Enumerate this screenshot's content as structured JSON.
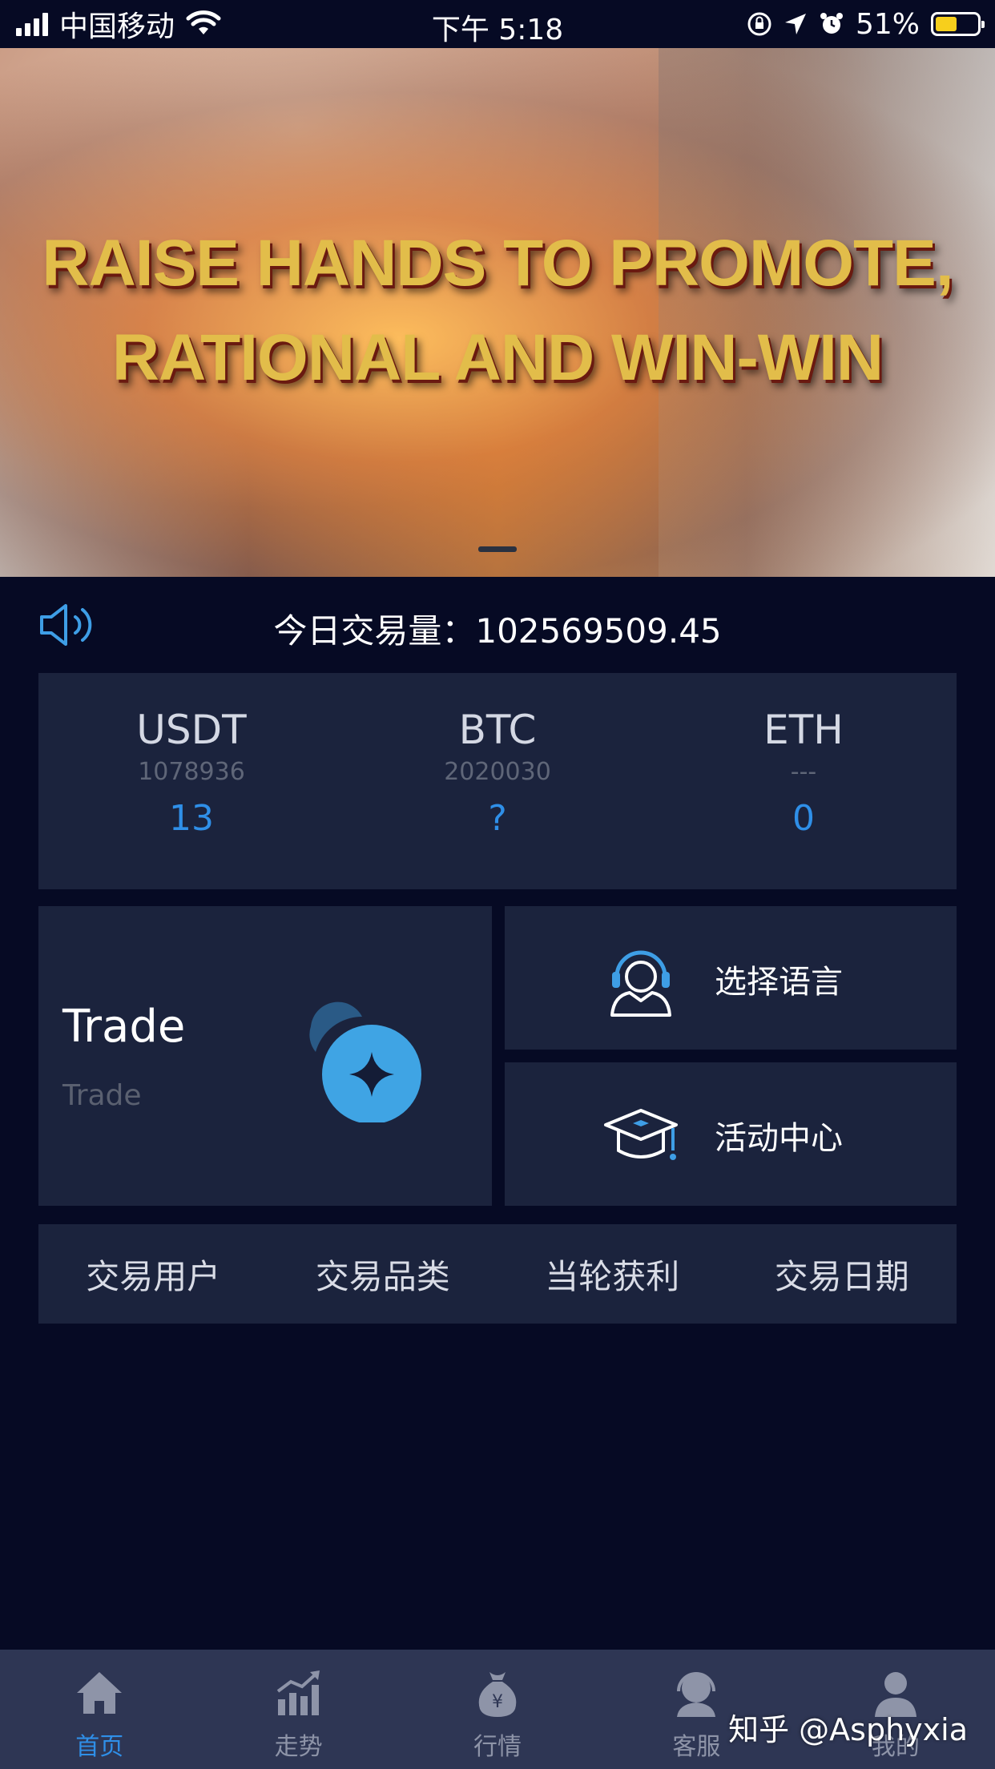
{
  "status_bar": {
    "carrier": "中国移动",
    "time": "下午 5:18",
    "battery": "51%",
    "battery_level": 0.51
  },
  "banner": {
    "line1": "RAISE HANDS TO PROMOTE,",
    "line2": "RATIONAL AND WIN-WIN"
  },
  "ticker": {
    "text": "今日交易量：102569509.45"
  },
  "coins": [
    {
      "name": "USDT",
      "sub": "1078936",
      "value": "13"
    },
    {
      "name": "BTC",
      "sub": "2020030",
      "value": "?"
    },
    {
      "name": "ETH",
      "sub": "---",
      "value": "0"
    }
  ],
  "trade_card": {
    "title": "Trade",
    "subtitle": "Trade"
  },
  "side_cards": {
    "language": "选择语言",
    "activity": "活动中心"
  },
  "table_headers": [
    "交易用户",
    "交易品类",
    "当轮获利",
    "交易日期"
  ],
  "tabs": [
    {
      "label": "首页",
      "icon": "home-icon"
    },
    {
      "label": "走势",
      "icon": "trend-chart-icon"
    },
    {
      "label": "行情",
      "icon": "money-bag-icon"
    },
    {
      "label": "客服",
      "icon": "customer-service-icon"
    },
    {
      "label": "我的",
      "icon": "user-icon"
    }
  ],
  "watermark": "知乎 @Asphyxia",
  "colors": {
    "background": "#060a24",
    "card": "#1b233d",
    "accent": "#2f8fe8",
    "tabbar": "#2e3654"
  }
}
